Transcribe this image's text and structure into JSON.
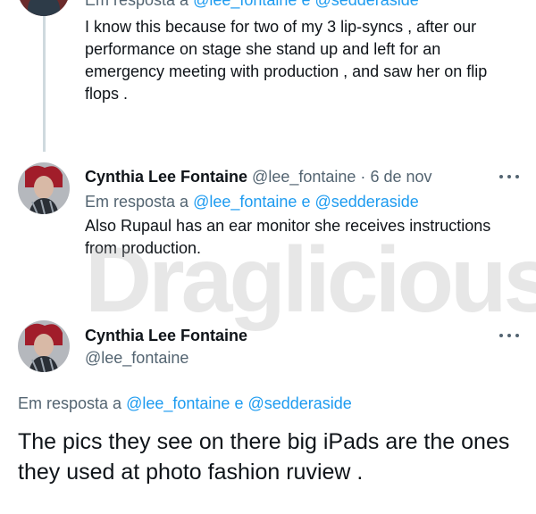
{
  "tweet1": {
    "reply_prefix": "Em resposta a",
    "reply_handles": "@lee_fontaine e @sedderaside",
    "text": "I know this because for two of my 3 lip-syncs , after our performance on stage she stand up and left for an emergency meeting with production , and saw her on flip flops ."
  },
  "tweet2": {
    "name": "Cynthia Lee Fontaine",
    "handle": "@lee_fontaine",
    "separator": "·",
    "date": "6 de nov",
    "reply_prefix": "Em resposta a",
    "reply_handles": "@lee_fontaine e @sedderaside",
    "text": "Also Rupaul has an ear monitor she receives instructions from production."
  },
  "tweet3": {
    "name": "Cynthia Lee Fontaine",
    "handle": "@lee_fontaine",
    "reply_prefix": "Em resposta a",
    "reply_handles": "@lee_fontaine e @sedderaside",
    "text": "The pics they see on there big iPads are the ones they used at photo fashion ruview ."
  },
  "watermark": "Draglicious",
  "colors": {
    "link": "#1d9bf0",
    "muted": "#536471",
    "text": "#0f1419",
    "thread_line": "#cfd9de"
  },
  "icons": {
    "more": "more-horizontal-icon"
  }
}
